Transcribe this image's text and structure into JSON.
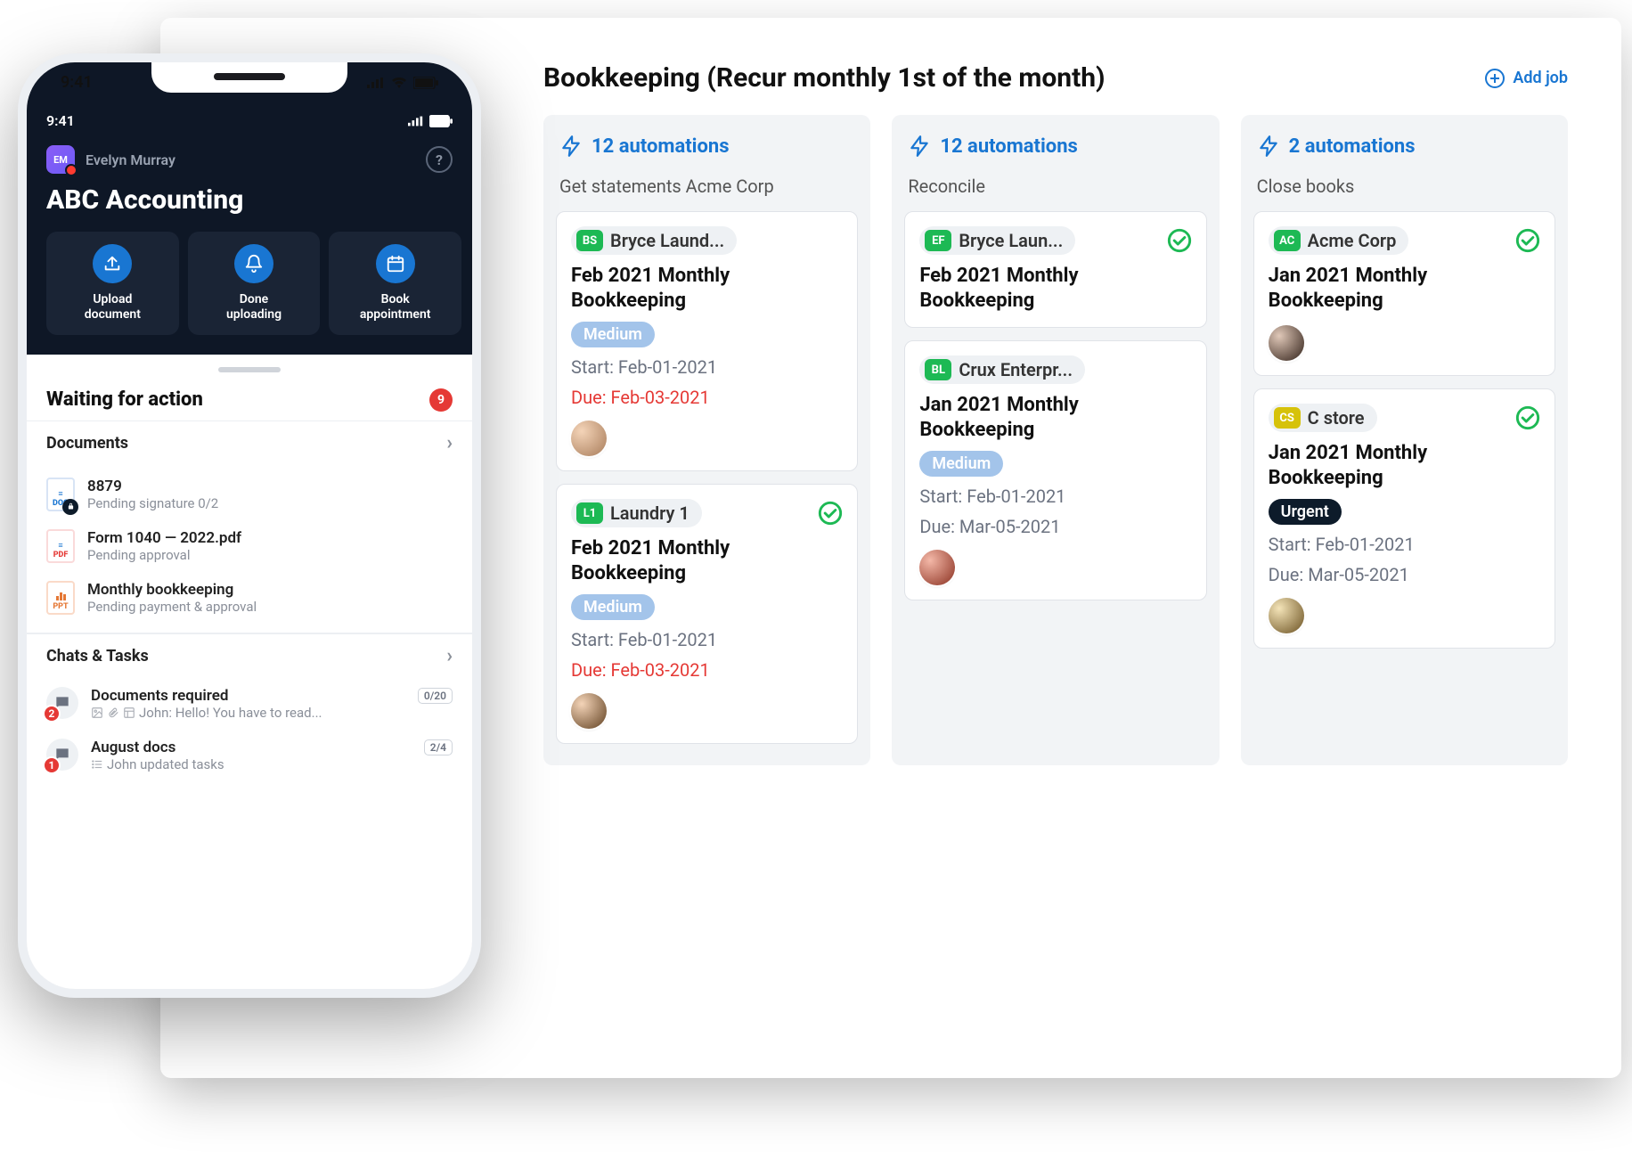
{
  "board": {
    "title": "Bookkeeping (Recur monthly 1st of the month)",
    "add_job_label": "Add job",
    "columns": [
      {
        "automations": "12 automations",
        "subtitle": "Get statements Acme Corp",
        "cards": [
          {
            "abbr": "BS",
            "client": "Bryce Laund...",
            "title": "Feb 2021 Monthly Bookkeeping",
            "badge": "Medium",
            "start": "Start: Feb-01-2021",
            "due": "Due: Feb-03-2021",
            "due_overdue": true,
            "checked": false,
            "avatar": "a1"
          },
          {
            "abbr": "L1",
            "client": "Laundry 1",
            "title": "Feb 2021 Monthly Bookkeeping",
            "badge": "Medium",
            "start": "Start: Feb-01-2021",
            "due": "Due: Feb-03-2021",
            "due_overdue": true,
            "checked": true,
            "avatar": "a2"
          }
        ]
      },
      {
        "automations": "12 automations",
        "subtitle": "Reconcile",
        "cards": [
          {
            "abbr": "EF",
            "client": "Bryce Laun...",
            "title": "Feb 2021 Monthly Bookkeeping",
            "checked": true
          },
          {
            "abbr": "BL",
            "client": "Crux Enterpr...",
            "title": "Jan 2021 Monthly Bookkeeping",
            "badge": "Medium",
            "start": "Start: Feb-01-2021",
            "due": "Due: Mar-05-2021",
            "due_overdue": false,
            "avatar": "a3"
          }
        ]
      },
      {
        "automations": "2 automations",
        "subtitle": "Close books",
        "cards": [
          {
            "abbr": "AC",
            "client": "Acme Corp",
            "title": "Jan 2021 Monthly Bookkeeping",
            "checked": true,
            "avatar": "a4"
          },
          {
            "abbr": "CS",
            "abbr_color": "yellow",
            "client": "C store",
            "title": "Jan 2021 Monthly Bookkeeping",
            "badge": "Urgent",
            "badge_class": "urgent",
            "start": "Start: Feb-01-2021",
            "due": "Due: Mar-05-2021",
            "due_overdue": false,
            "checked": true,
            "avatar": "a5"
          }
        ]
      }
    ]
  },
  "phone": {
    "outer_time": "9:41",
    "inner_time": "9:41",
    "user_initials": "EM",
    "user_name": "Evelyn Murray",
    "company": "ABC Accounting",
    "tiles": [
      {
        "label": "Upload document"
      },
      {
        "label": "Done uploading"
      },
      {
        "label": "Book appointment"
      }
    ],
    "waiting_title": "Waiting for action",
    "waiting_count": "9",
    "docs_title": "Documents",
    "docs": [
      {
        "ext": "DOC",
        "title": "8879",
        "sub": "Pending signature 0/2",
        "lock": true
      },
      {
        "ext": "PDF",
        "cls": "pdf",
        "title": "Form 1040 — 2022.pdf",
        "sub": "Pending approval"
      },
      {
        "ext": "PPT",
        "cls": "ppt",
        "bars": true,
        "title": "Monthly bookkeeping",
        "sub": "Pending payment & approval"
      }
    ],
    "chats_title": "Chats & Tasks",
    "chats": [
      {
        "badge": "2",
        "title": "Documents required",
        "count": "0/20",
        "sub": "John: Hello! You have to read...",
        "icons": true
      },
      {
        "badge": "1",
        "title": "August docs",
        "count": "2/4",
        "sub": "John updated tasks",
        "list_icon": true
      }
    ]
  }
}
